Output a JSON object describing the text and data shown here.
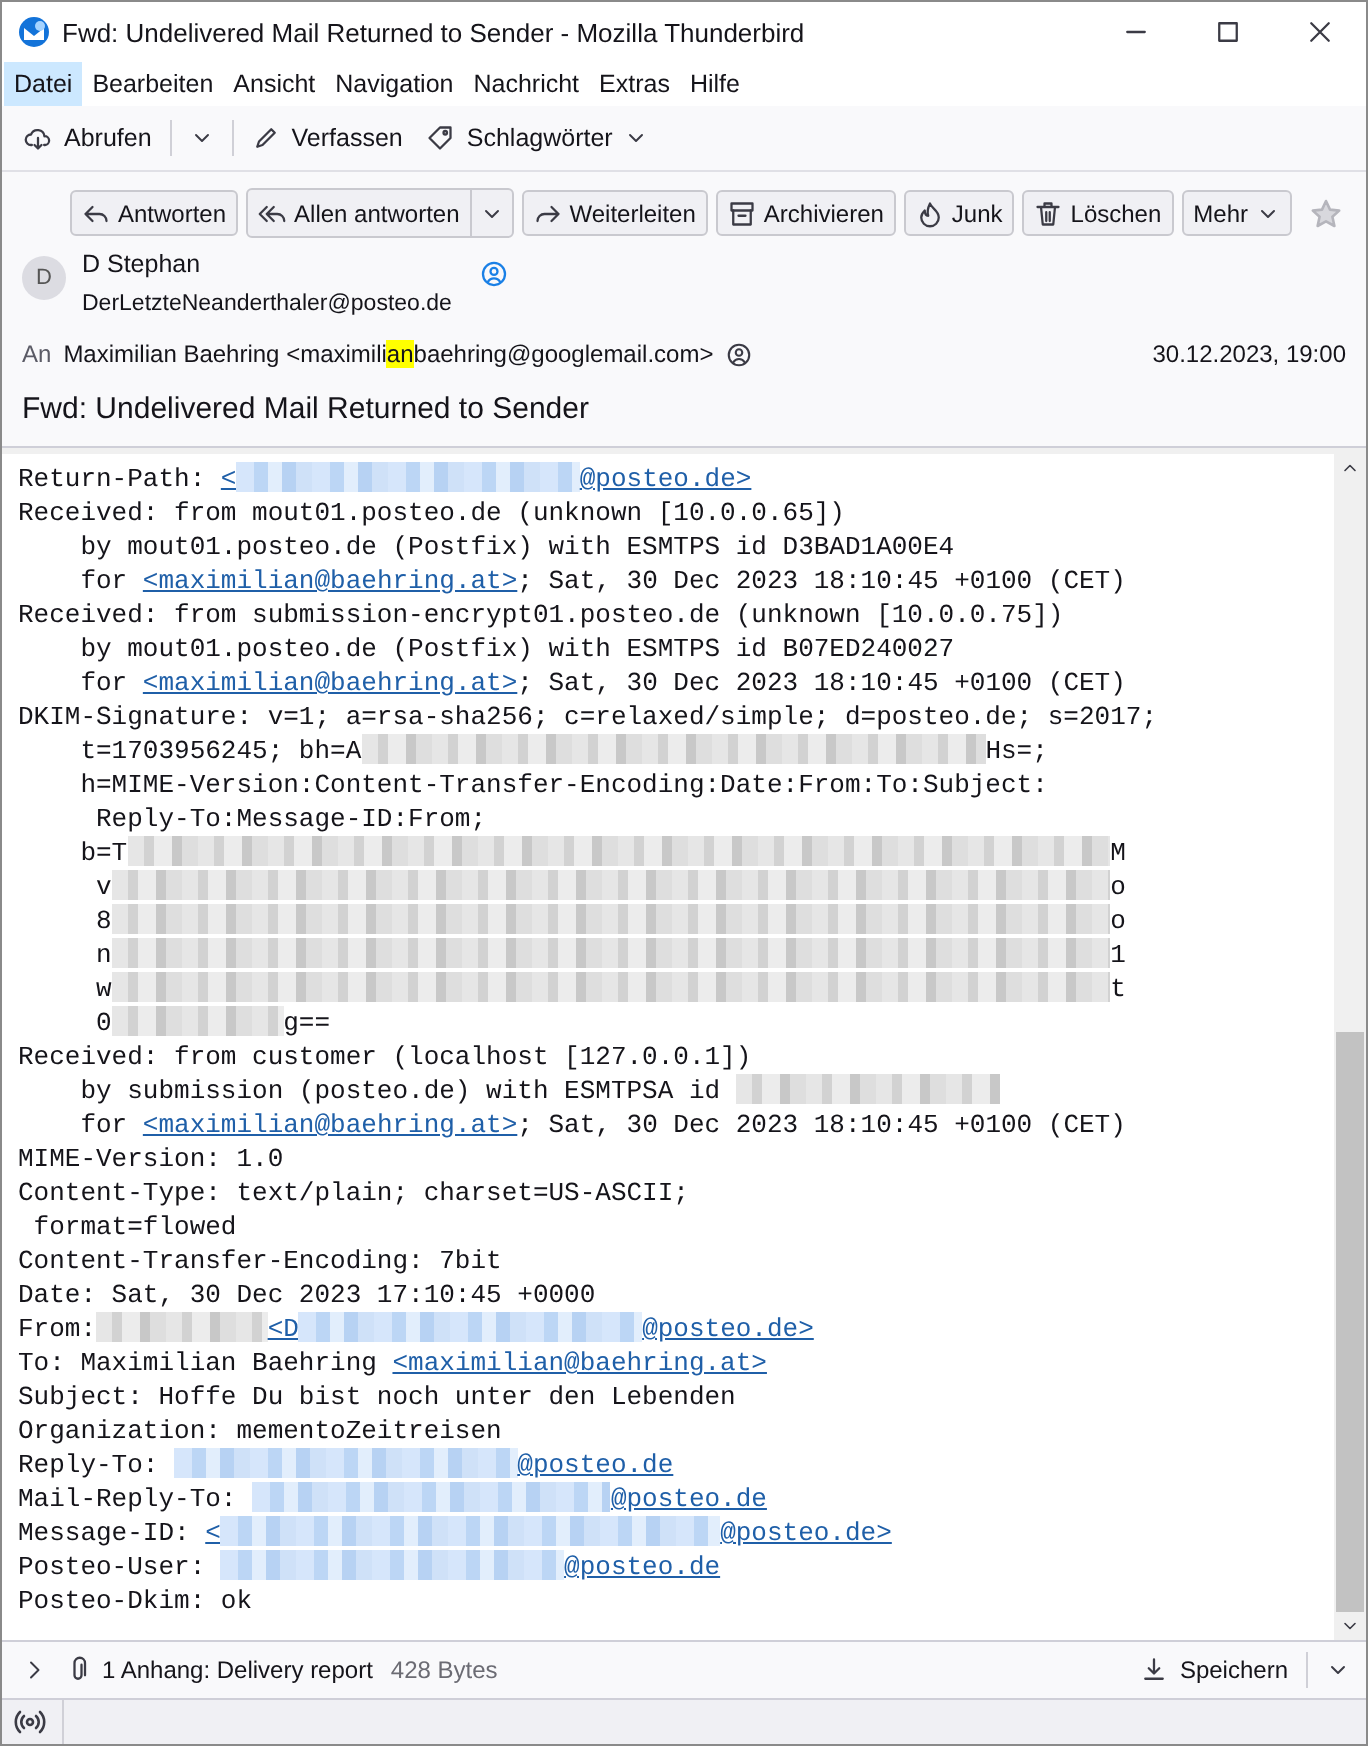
{
  "window": {
    "title": "Fwd: Undelivered Mail Returned to Sender - Mozilla Thunderbird"
  },
  "menu": [
    {
      "label": "Datei",
      "selected": true
    },
    {
      "label": "Bearbeiten",
      "selected": false
    },
    {
      "label": "Ansicht",
      "selected": false
    },
    {
      "label": "Navigation",
      "selected": false
    },
    {
      "label": "Nachricht",
      "selected": false
    },
    {
      "label": "Extras",
      "selected": false
    },
    {
      "label": "Hilfe",
      "selected": false
    }
  ],
  "toolbar": [
    {
      "kind": "split",
      "label": "Abrufen"
    },
    {
      "kind": "button",
      "label": "Verfassen"
    },
    {
      "kind": "menu",
      "label": "Schlagwörter"
    }
  ],
  "message_actions": [
    {
      "kind": "button",
      "label": "Antworten"
    },
    {
      "kind": "split",
      "label": "Allen antworten"
    },
    {
      "kind": "button",
      "label": "Weiterleiten"
    },
    {
      "kind": "button",
      "label": "Archivieren"
    },
    {
      "kind": "button",
      "label": "Junk"
    },
    {
      "kind": "button",
      "label": "Löschen"
    },
    {
      "kind": "menu",
      "label": "Mehr"
    }
  ],
  "starred": false,
  "header": {
    "avatar": "D",
    "name": "D Stephan",
    "email": "DerLetzteNeanderthaler@posteo.de",
    "to_label": "An",
    "recipient": {
      "before": "Maximilian Baehring <maximili",
      "highlight": "an",
      "after": "baehring@googlemail.com>"
    },
    "date": "30.12.2023, 19:00",
    "subject": "Fwd: Undelivered Mail Returned to Sender"
  },
  "body_lines": [
    [
      {
        "kind": "text",
        "text": "Return-Path: "
      },
      {
        "kind": "link",
        "parts": [
          {
            "kind": "text",
            "text": "<"
          },
          {
            "kind": "blur"
          },
          {
            "kind": "text",
            "text": "@posteo.de>"
          }
        ]
      }
    ],
    [
      {
        "kind": "text",
        "text": "Received: from mout01.posteo.de (unknown [10.0.0.65])"
      }
    ],
    [
      {
        "kind": "text",
        "text": "    by mout01.posteo.de (Postfix) with ESMTPS id D3BAD1A00E4"
      }
    ],
    [
      {
        "kind": "text",
        "text": "    for "
      },
      {
        "kind": "link",
        "parts": [
          {
            "kind": "text",
            "text": "<maximilian@baehring.at>"
          }
        ]
      },
      {
        "kind": "text",
        "text": "; Sat, 30 Dec 2023 18:10:45 +0100 (CET)"
      }
    ],
    [
      {
        "kind": "text",
        "text": "Received: from submission-encrypt01.posteo.de (unknown [10.0.0.75])"
      }
    ],
    [
      {
        "kind": "text",
        "text": "    by mout01.posteo.de (Postfix) with ESMTPS id B07ED240027"
      }
    ],
    [
      {
        "kind": "text",
        "text": "    for "
      },
      {
        "kind": "link",
        "parts": [
          {
            "kind": "text",
            "text": "<maximilian@baehring.at>"
          }
        ]
      },
      {
        "kind": "text",
        "text": "; Sat, 30 Dec 2023 18:10:45 +0100 (CET)"
      }
    ],
    [
      {
        "kind": "text",
        "text": "DKIM-Signature: v=1; a=rsa-sha256; c=relaxed/simple; d=posteo.de; s=2017;"
      }
    ],
    [
      {
        "kind": "text",
        "text": "    t=1703956245; bh=A"
      },
      {
        "kind": "blur"
      },
      {
        "kind": "text",
        "text": "Hs=;"
      }
    ],
    [
      {
        "kind": "text",
        "text": "    h=MIME-Version:Content-Transfer-Encoding:Date:From:To:Subject:"
      }
    ],
    [
      {
        "kind": "text",
        "text": "     Reply-To:Message-ID:From;"
      }
    ],
    [
      {
        "kind": "text",
        "text": "    b=T"
      },
      {
        "kind": "blur"
      },
      {
        "kind": "text",
        "text": "M"
      }
    ],
    [
      {
        "kind": "text",
        "text": "     v"
      },
      {
        "kind": "blur"
      },
      {
        "kind": "text",
        "text": "o"
      }
    ],
    [
      {
        "kind": "text",
        "text": "     8"
      },
      {
        "kind": "blur"
      },
      {
        "kind": "text",
        "text": "o"
      }
    ],
    [
      {
        "kind": "text",
        "text": "     n"
      },
      {
        "kind": "blur"
      },
      {
        "kind": "text",
        "text": "1"
      }
    ],
    [
      {
        "kind": "text",
        "text": "     w"
      },
      {
        "kind": "blur"
      },
      {
        "kind": "text",
        "text": "t"
      }
    ],
    [
      {
        "kind": "text",
        "text": "     0"
      },
      {
        "kind": "blur"
      },
      {
        "kind": "text",
        "text": "g=="
      }
    ],
    [
      {
        "kind": "text",
        "text": "Received: from customer (localhost [127.0.0.1])"
      }
    ],
    [
      {
        "kind": "text",
        "text": "    by submission (posteo.de) with ESMTPSA id "
      },
      {
        "kind": "blur"
      }
    ],
    [
      {
        "kind": "text",
        "text": "    for "
      },
      {
        "kind": "link",
        "parts": [
          {
            "kind": "text",
            "text": "<maximilian@baehring.at>"
          }
        ]
      },
      {
        "kind": "text",
        "text": "; Sat, 30 Dec 2023 18:10:45 +0100 (CET)"
      }
    ],
    [
      {
        "kind": "text",
        "text": "MIME-Version: 1.0"
      }
    ],
    [
      {
        "kind": "text",
        "text": "Content-Type: text/plain; charset=US-ASCII;"
      }
    ],
    [
      {
        "kind": "text",
        "text": " format=flowed"
      }
    ],
    [
      {
        "kind": "text",
        "text": "Content-Transfer-Encoding: 7bit"
      }
    ],
    [
      {
        "kind": "text",
        "text": "Date: Sat, 30 Dec 2023 17:10:45 +0000"
      }
    ],
    [
      {
        "kind": "text",
        "text": "From:"
      },
      {
        "kind": "blur"
      },
      {
        "kind": "link",
        "parts": [
          {
            "kind": "text",
            "text": "<D"
          },
          {
            "kind": "blur"
          },
          {
            "kind": "text",
            "text": "@posteo.de>"
          }
        ]
      }
    ],
    [
      {
        "kind": "text",
        "text": "To: Maximilian Baehring "
      },
      {
        "kind": "link",
        "parts": [
          {
            "kind": "text",
            "text": "<maximilian@baehring.at>"
          }
        ]
      }
    ],
    [
      {
        "kind": "text",
        "text": "Subject: Hoffe Du bist noch unter den Lebenden"
      }
    ],
    [
      {
        "kind": "text",
        "text": "Organization: mementoZeitreisen"
      }
    ],
    [
      {
        "kind": "text",
        "text": "Reply-To: "
      },
      {
        "kind": "link",
        "parts": [
          {
            "kind": "blur"
          },
          {
            "kind": "text",
            "text": "@posteo.de"
          }
        ]
      }
    ],
    [
      {
        "kind": "text",
        "text": "Mail-Reply-To: "
      },
      {
        "kind": "link",
        "parts": [
          {
            "kind": "blur"
          },
          {
            "kind": "text",
            "text": "@posteo.de"
          }
        ]
      }
    ],
    [
      {
        "kind": "text",
        "text": "Message-ID: "
      },
      {
        "kind": "link",
        "parts": [
          {
            "kind": "text",
            "text": "<"
          },
          {
            "kind": "blur"
          },
          {
            "kind": "text",
            "text": "@posteo.de>"
          }
        ]
      }
    ],
    [
      {
        "kind": "text",
        "text": "Posteo-User: "
      },
      {
        "kind": "link",
        "parts": [
          {
            "kind": "blur"
          },
          {
            "kind": "text",
            "text": "@posteo.de"
          }
        ]
      }
    ],
    [
      {
        "kind": "text",
        "text": "Posteo-Dkim: ok"
      }
    ]
  ],
  "attachment": {
    "summary": "1 Anhang: Delivery report",
    "size": "428 Bytes",
    "save_label": "Speichern"
  }
}
